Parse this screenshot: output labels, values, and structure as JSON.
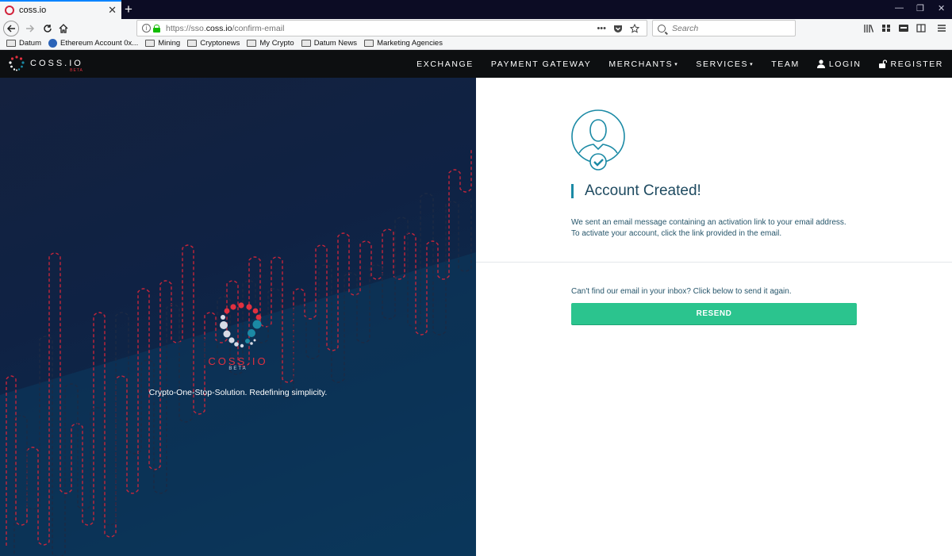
{
  "browser": {
    "tab_title": "coss.io",
    "tab_close": "✕",
    "new_tab": "+",
    "window_controls": [
      "—",
      "❐",
      "✕"
    ],
    "url_prefix": "https://sso.",
    "url_domain": "coss.io",
    "url_path": "/confirm-email",
    "page_actions": "•••",
    "search_placeholder": "Search",
    "bookmarks": [
      {
        "label": "Datum",
        "icon": "folder-icon"
      },
      {
        "label": "Ethereum Account 0x...",
        "icon": "ethereum-icon"
      },
      {
        "label": "Mining",
        "icon": "folder-icon"
      },
      {
        "label": "Cryptonews",
        "icon": "folder-icon"
      },
      {
        "label": "My Crypto",
        "icon": "folder-icon"
      },
      {
        "label": "Datum News",
        "icon": "folder-icon"
      },
      {
        "label": "Marketing Agencies",
        "icon": "folder-icon"
      }
    ]
  },
  "header": {
    "brand_name": "COSS.IO",
    "brand_beta": "BETA",
    "nav": {
      "exchange": "EXCHANGE",
      "payment_gateway": "PAYMENT GATEWAY",
      "merchants": "MERCHANTS",
      "services": "SERVICES",
      "team": "TEAM",
      "login": "LOGIN",
      "register": "REGISTER"
    },
    "dropdown_caret": "▾"
  },
  "hero": {
    "logo_name": "COSS.IO",
    "logo_beta": "BETA",
    "tagline": "Crypto-One-Stop-Solution. Redefining simplicity."
  },
  "panel": {
    "title": "Account Created!",
    "message_line1": "We sent an email message containing an activation link to your email address.",
    "message_line2": "To activate your account, click the link provided in the email.",
    "resend_prompt": "Can't find our email in your inbox? Click below to send it again.",
    "resend_button": "RESEND"
  },
  "colors": {
    "accent_teal": "#1b8aa5",
    "button_green": "#2bc48e",
    "brand_red": "#e0303f",
    "header_bg": "#0d0f11",
    "hero_bg": "#13223f"
  }
}
